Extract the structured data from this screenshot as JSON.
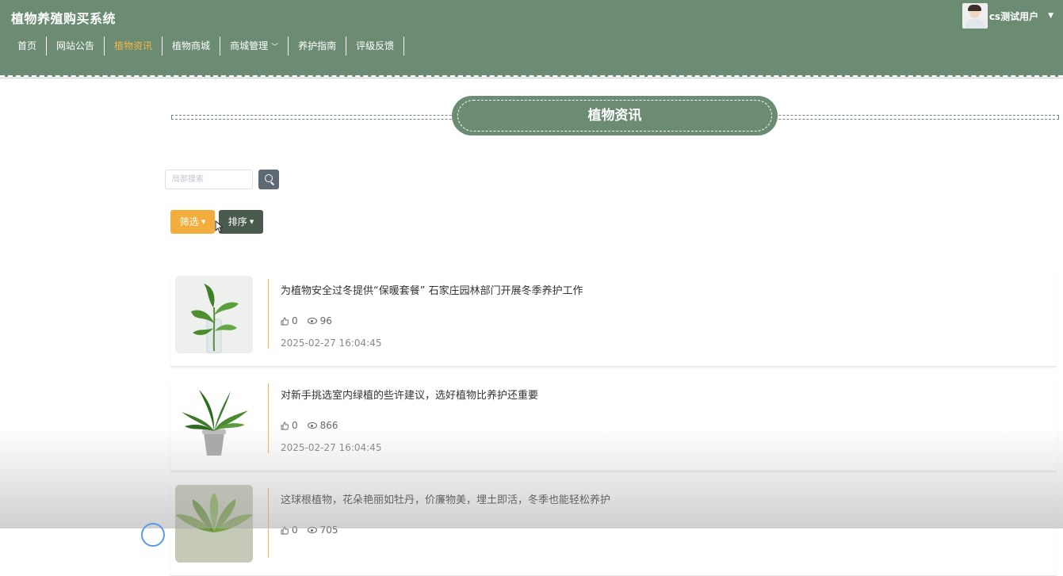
{
  "app": {
    "title": "植物养殖购买系统"
  },
  "user": {
    "name": "cs测试用户"
  },
  "nav": {
    "items": [
      {
        "label": "首页",
        "active": false
      },
      {
        "label": "网站公告",
        "active": false
      },
      {
        "label": "植物资讯",
        "active": true
      },
      {
        "label": "植物商城",
        "active": false
      },
      {
        "label": "商城管理",
        "active": false,
        "dropdown": true
      },
      {
        "label": "养护指南",
        "active": false
      },
      {
        "label": "评级反馈",
        "active": false
      }
    ]
  },
  "section": {
    "title": "植物资讯"
  },
  "search": {
    "placeholder": "局部搜索",
    "value": ""
  },
  "toolbar": {
    "filter_label": "筛选",
    "sort_label": "排序"
  },
  "news": [
    {
      "title": "为植物安全过冬提供“保暖套餐” 石家庄园林部门开展冬季养护工作",
      "likes": "0",
      "views": "96",
      "date": "2025-02-27 16:04:45",
      "thumb": "pothos-in-vase"
    },
    {
      "title": "对新手挑选室内绿植的些许建议，选好植物比养护还重要",
      "likes": "0",
      "views": "866",
      "date": "2025-02-27 16:04:45",
      "thumb": "potted-plant"
    },
    {
      "title": "这球根植物，花朵艳丽如牡丹，价廉物美，埋土即活，冬季也能轻松养护",
      "likes": "0",
      "views": "705",
      "date": "",
      "thumb": "succulent"
    }
  ],
  "colors": {
    "header": "#6b8b73",
    "accent": "#f3b64a",
    "filter_button": "#f3ad3c",
    "sort_button": "#4a5b4e"
  }
}
